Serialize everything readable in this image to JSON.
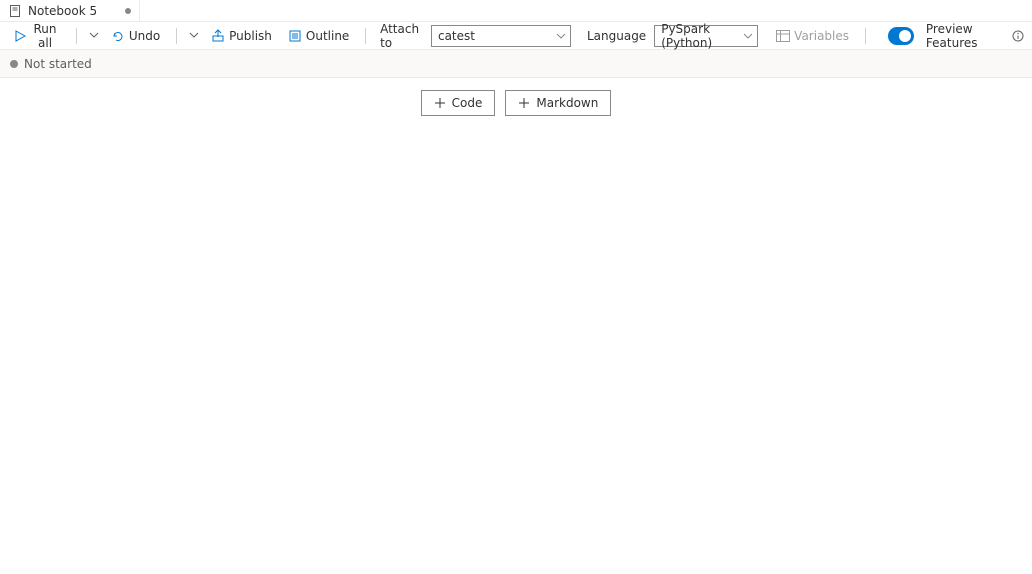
{
  "tab": {
    "title": "Notebook 5"
  },
  "toolbar": {
    "run_all": "Run all",
    "undo": "Undo",
    "publish": "Publish",
    "outline": "Outline",
    "attach_to_label": "Attach to",
    "attach_to_value": "catest",
    "language_label": "Language",
    "language_value": "PySpark (Python)",
    "variables": "Variables",
    "preview_features": "Preview Features"
  },
  "status": {
    "text": "Not started"
  },
  "cells": {
    "add_code": "Code",
    "add_markdown": "Markdown"
  }
}
